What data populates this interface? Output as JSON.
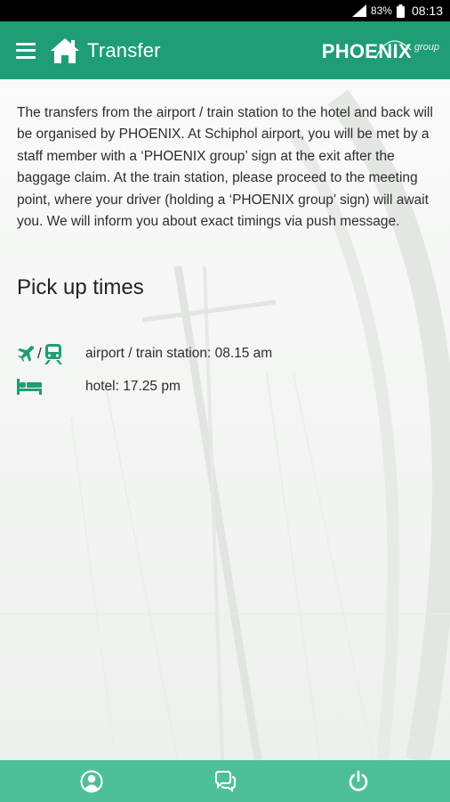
{
  "status_bar": {
    "battery": "83%",
    "time": "08:13"
  },
  "app_bar": {
    "title": "Transfer",
    "brand": "PHOENIX",
    "brand_sub": "group"
  },
  "intro_text": "The transfers from the airport / train station to the hotel and back will be organised by PHOENIX. At Schiphol airport, you will be met by a staff member with a ‘PHOENIX group’ sign at the exit after the baggage claim. At the train station, please proceed to the meeting point, where your driver (holding a ‘PHOENIX group’ sign) will await you. We will inform you about exact timings via push message.",
  "pickup": {
    "title": "Pick up times",
    "rows": [
      {
        "icons": [
          "airplane-icon",
          "train-icon"
        ],
        "separator": "/",
        "text": "airport / train station: 08.15 am"
      },
      {
        "icons": [
          "bed-icon"
        ],
        "text": "hotel: 17.25 pm"
      }
    ]
  },
  "bottom_nav": {
    "items": [
      "profile-icon",
      "chat-icon",
      "power-icon"
    ]
  },
  "colors": {
    "primary": "#1e9d77",
    "bottom_bar": "#4ec099",
    "background": "#f6f7f6"
  }
}
